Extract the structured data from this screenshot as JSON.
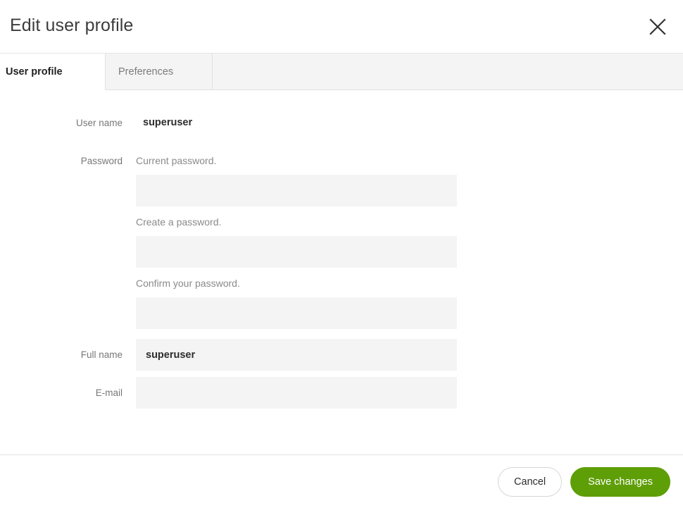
{
  "dialog": {
    "title": "Edit user profile",
    "close_icon": "close-icon"
  },
  "tabs": [
    {
      "label": "User profile",
      "active": true
    },
    {
      "label": "Preferences",
      "active": false
    }
  ],
  "form": {
    "username": {
      "label": "User name",
      "value": "superuser"
    },
    "password": {
      "label": "Password",
      "current": {
        "helper": "Current password.",
        "value": "",
        "placeholder": ""
      },
      "create": {
        "helper": "Create a password.",
        "value": "",
        "placeholder": ""
      },
      "confirm": {
        "helper": "Confirm your password.",
        "value": "",
        "placeholder": ""
      }
    },
    "fullname": {
      "label": "Full name",
      "value": "superuser",
      "placeholder": ""
    },
    "email": {
      "label": "E-mail",
      "value": "",
      "placeholder": ""
    }
  },
  "footer": {
    "cancel_label": "Cancel",
    "save_label": "Save changes"
  },
  "colors": {
    "accent_green": "#5e9e07",
    "input_background": "#f4f4f4",
    "tab_inactive_background": "#f4f4f4",
    "border": "#e4e4e4",
    "label_text": "#777777",
    "helper_text": "#8a8a8a"
  }
}
